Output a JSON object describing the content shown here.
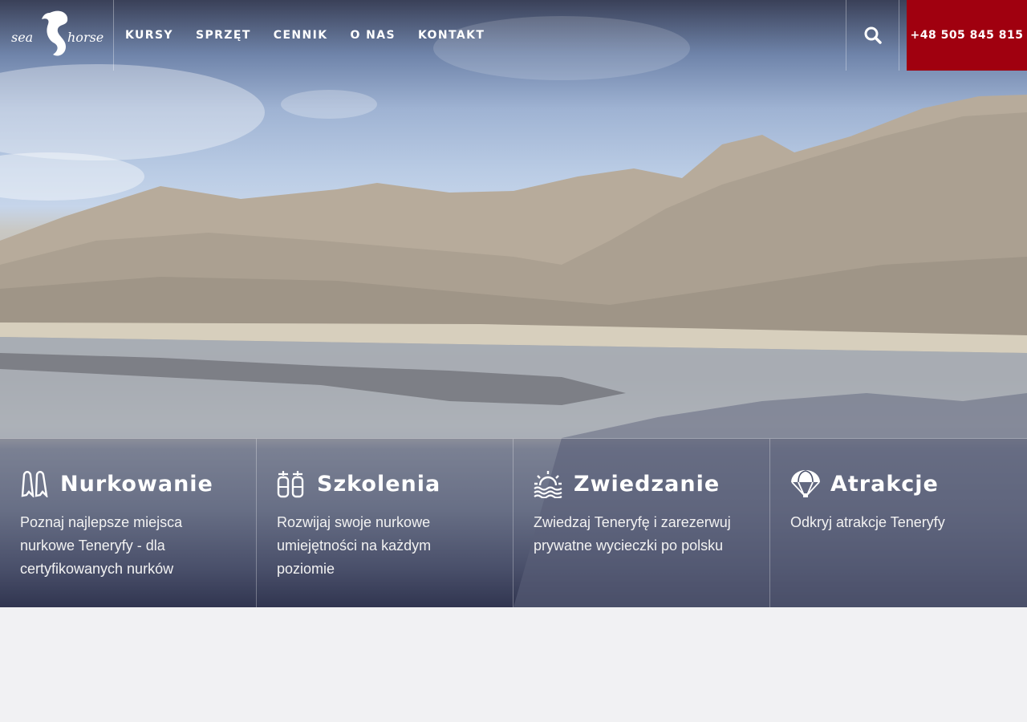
{
  "brand": {
    "logo_text_left": "sea",
    "logo_text_right": "horse",
    "logo_icon": "seahorse-icon"
  },
  "nav": {
    "items": [
      {
        "label": "KURSY"
      },
      {
        "label": "SPRZĘT"
      },
      {
        "label": "CENNIK"
      },
      {
        "label": "O NAS"
      },
      {
        "label": "KONTAKT"
      }
    ]
  },
  "search": {
    "icon": "search-icon"
  },
  "phone": {
    "label": "+48 505 845 815",
    "background": "#a0000f"
  },
  "features": [
    {
      "icon": "fins-icon",
      "title": "Nurkowanie",
      "text": "Poznaj najlepsze miejsca nurkowe Teneryfy - dla certyfikowanych nurków"
    },
    {
      "icon": "scuba-tanks-icon",
      "title": "Szkolenia",
      "text": "Rozwijaj swoje nurkowe umiejętności na każdym poziomie"
    },
    {
      "icon": "sunset-waves-icon",
      "title": "Zwiedzanie",
      "text": "Zwiedzaj Teneryfę i zarezerwuj prywatne wycieczki po polsku"
    },
    {
      "icon": "parachute-icon",
      "title": "Atrakcje",
      "text": "Odkryj atrakcje Teneryfy"
    }
  ]
}
